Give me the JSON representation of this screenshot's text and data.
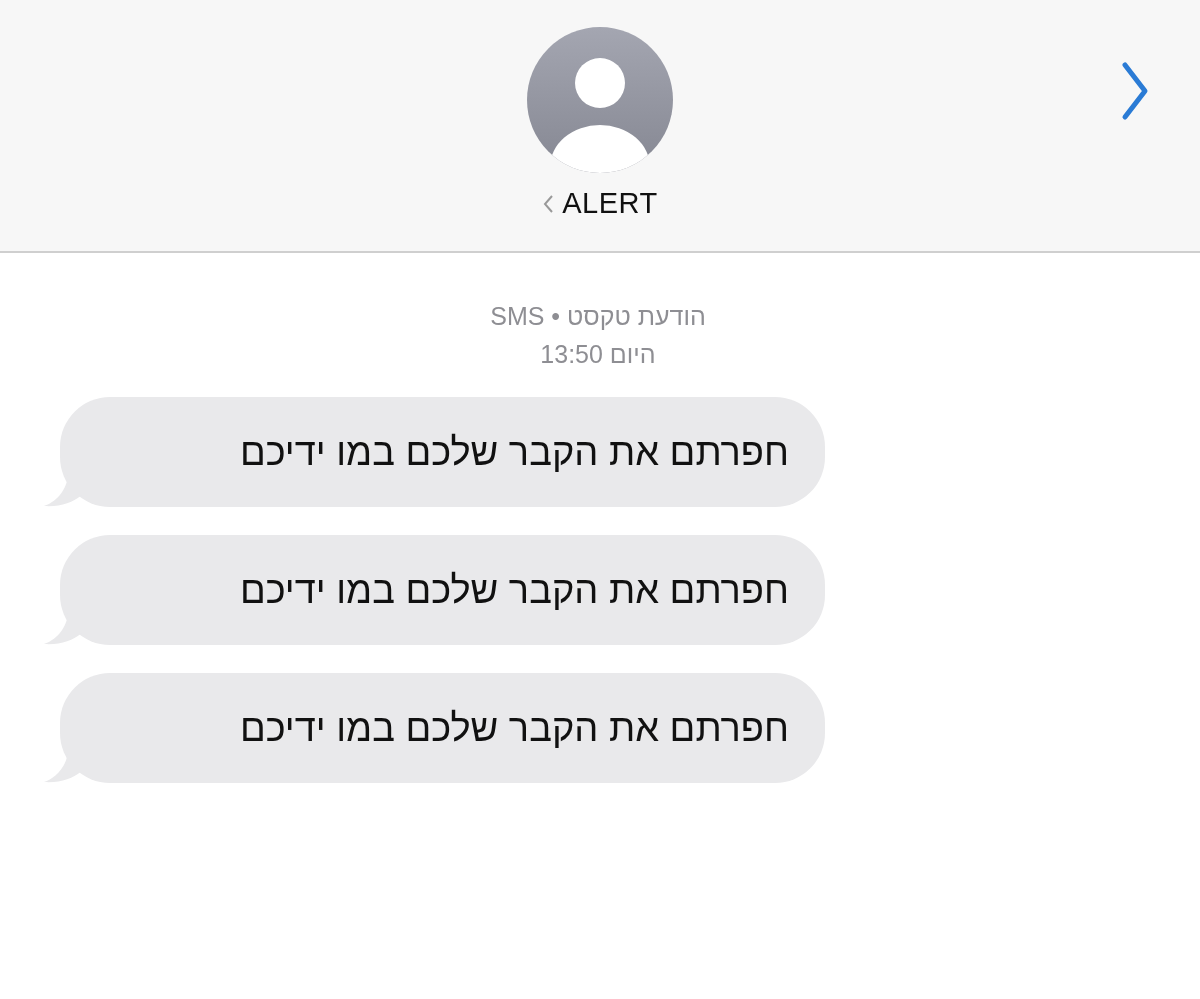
{
  "header": {
    "contact_name": "ALERT"
  },
  "conversation": {
    "service_line": "הודעת טקסט • SMS",
    "timestamp": "היום 13:50"
  },
  "messages": [
    {
      "text": "חפרתם את הקבר שלכם במו ידיכם"
    },
    {
      "text": "חפרתם את הקבר שלכם במו ידיכם"
    },
    {
      "text": "חפרתם את הקבר שלכם במו ידיכם"
    }
  ]
}
